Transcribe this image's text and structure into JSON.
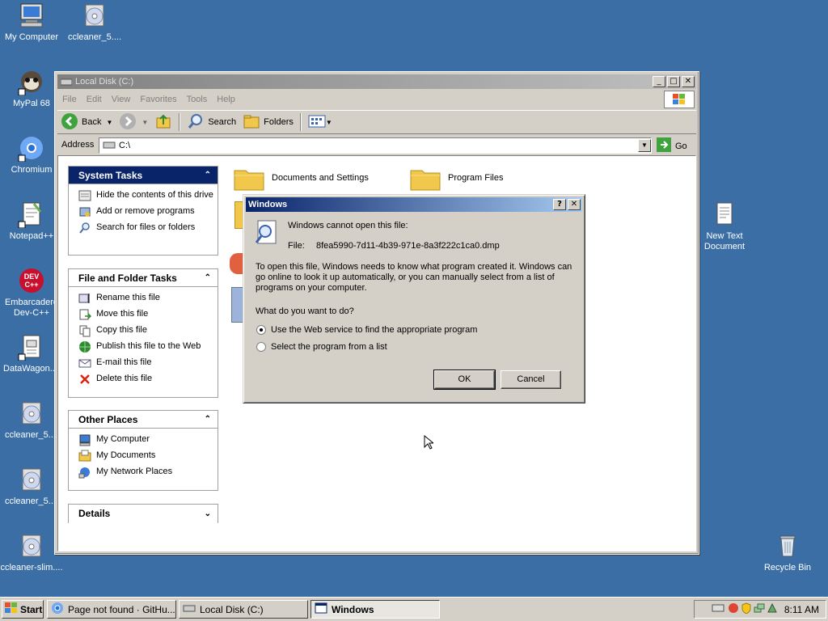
{
  "desktop": {
    "icons_left": [
      {
        "label": "My Computer",
        "icon": "my-computer-icon"
      },
      {
        "label": "ccleaner_5....",
        "icon": "cd-installer-icon"
      },
      {
        "label": "MyPal 68",
        "icon": "mypal-icon"
      },
      {
        "label": "Chromium",
        "icon": "chromium-icon"
      },
      {
        "label": "Notepad++",
        "icon": "notepadpp-icon"
      },
      {
        "label": "Embarcadero Dev-C++",
        "icon": "devcpp-icon"
      },
      {
        "label": "DataWagon....",
        "icon": "datawagon-icon"
      },
      {
        "label": "ccleaner_5....",
        "icon": "cd-installer-icon"
      },
      {
        "label": "ccleaner_5....",
        "icon": "cd-installer-icon"
      },
      {
        "label": "ccleaner-slim....",
        "icon": "cd-installer-icon"
      }
    ],
    "icons_right": [
      {
        "label": "New Text Document",
        "icon": "text-document-icon"
      },
      {
        "label": "Recycle Bin",
        "icon": "recycle-bin-icon"
      }
    ],
    "devcpp_badge": "DEV\nC++"
  },
  "explorer": {
    "title": "Local Disk (C:)",
    "menu": [
      "File",
      "Edit",
      "View",
      "Favorites",
      "Tools",
      "Help"
    ],
    "toolbar": {
      "back": "Back",
      "search": "Search",
      "folders": "Folders"
    },
    "address_label": "Address",
    "address_value": "C:\\",
    "go_label": "Go",
    "system_tasks": {
      "title": "System Tasks",
      "items": [
        "Hide the contents of this drive",
        "Add or remove programs",
        "Search for files or folders"
      ]
    },
    "file_tasks": {
      "title": "File and Folder Tasks",
      "items": [
        "Rename this file",
        "Move this file",
        "Copy this file",
        "Publish this file to the Web",
        "E-mail this file",
        "Delete this file"
      ]
    },
    "other_places": {
      "title": "Other Places",
      "items": [
        "My Computer",
        "My Documents",
        "My Network Places"
      ]
    },
    "details": {
      "title": "Details"
    },
    "folders": [
      "Documents and Settings",
      "Program Files"
    ]
  },
  "dialog": {
    "title": "Windows",
    "heading": "Windows cannot open this file:",
    "file_label": "File:",
    "file_name": "8fea5990-7d11-4b39-971e-8a3f222c1ca0.dmp",
    "body": "To open this file, Windows needs to know what program created it.  Windows can go online to look it up automatically, or you can manually select from a list of programs on your computer.",
    "question": "What do you want to do?",
    "option_web": "Use the Web service to find the appropriate program",
    "option_list": "Select the program from a list",
    "selected_option": "web",
    "ok": "OK",
    "cancel": "Cancel"
  },
  "taskbar": {
    "start": "Start",
    "tasks": [
      {
        "label": "Page not found · GitHu...",
        "active": false
      },
      {
        "label": "Local Disk (C:)",
        "active": false
      },
      {
        "label": "Windows",
        "active": true
      }
    ],
    "clock": "8:11 AM"
  },
  "colors": {
    "desktop": "#3a6ea5",
    "active_title": "#0a246a",
    "inactive_title": "#808080",
    "panel_header_dark": "#0a246a"
  }
}
